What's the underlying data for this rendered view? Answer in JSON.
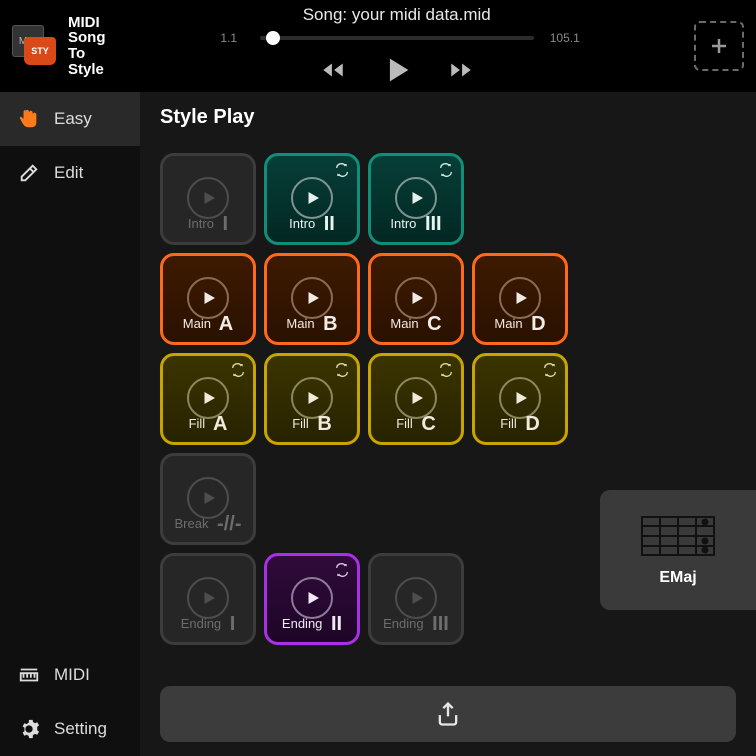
{
  "app": {
    "name_lines": [
      "MIDI",
      "Song",
      "To",
      "Style"
    ],
    "note_badge": "MID",
    "sty_badge": "STY"
  },
  "header": {
    "song_label": "Song: your midi data.mid",
    "pos_start": "1.1",
    "pos_end": "105.1"
  },
  "sidebar": {
    "items": [
      {
        "id": "easy",
        "label": "Easy",
        "active": true
      },
      {
        "id": "edit",
        "label": "Edit",
        "active": false
      },
      {
        "id": "midi",
        "label": "MIDI",
        "active": false
      },
      {
        "id": "setting",
        "label": "Setting",
        "active": false
      }
    ]
  },
  "page": {
    "title": "Style Play"
  },
  "tiles": {
    "intro": [
      {
        "word": "Intro",
        "big": "I",
        "theme": "gray",
        "loop": false
      },
      {
        "word": "Intro",
        "big": "II",
        "theme": "teal",
        "loop": true
      },
      {
        "word": "Intro",
        "big": "III",
        "theme": "teal",
        "loop": true
      }
    ],
    "main": [
      {
        "word": "Main",
        "big": "A",
        "theme": "orange",
        "loop": false
      },
      {
        "word": "Main",
        "big": "B",
        "theme": "orange",
        "loop": false
      },
      {
        "word": "Main",
        "big": "C",
        "theme": "orange",
        "loop": false
      },
      {
        "word": "Main",
        "big": "D",
        "theme": "orange",
        "loop": false
      }
    ],
    "fill": [
      {
        "word": "Fill",
        "big": "A",
        "theme": "olive",
        "loop": true
      },
      {
        "word": "Fill",
        "big": "B",
        "theme": "olive",
        "loop": true
      },
      {
        "word": "Fill",
        "big": "C",
        "theme": "olive",
        "loop": true
      },
      {
        "word": "Fill",
        "big": "D",
        "theme": "olive",
        "loop": true
      }
    ],
    "break": [
      {
        "word": "Break",
        "big": "-//-",
        "theme": "gray",
        "loop": false
      }
    ],
    "ending": [
      {
        "word": "Ending",
        "big": "I",
        "theme": "gray",
        "loop": false
      },
      {
        "word": "Ending",
        "big": "II",
        "theme": "purple",
        "loop": true
      },
      {
        "word": "Ending",
        "big": "III",
        "theme": "gray",
        "loop": false
      }
    ]
  },
  "chord": {
    "name": "EMaj"
  }
}
